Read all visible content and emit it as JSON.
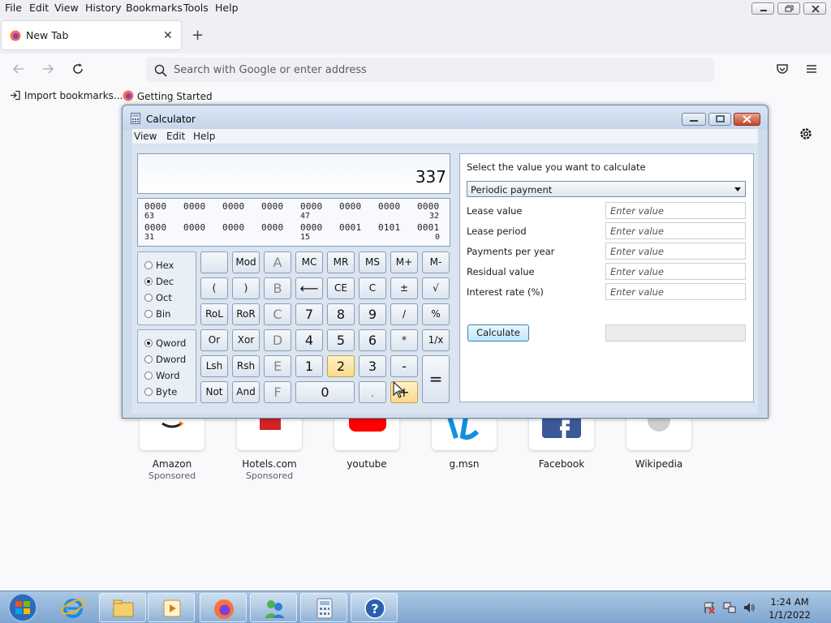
{
  "browser": {
    "menu": [
      "File",
      "Edit",
      "View",
      "History",
      "Bookmarks",
      "Tools",
      "Help"
    ],
    "tab_title": "New Tab",
    "address_placeholder": "Search with Google or enter address",
    "bookmarks": [
      "Import bookmarks...",
      "Getting Started"
    ]
  },
  "shortcuts": [
    {
      "label": "Amazon",
      "sub": "Sponsored"
    },
    {
      "label": "Hotels.com",
      "sub": "Sponsored"
    },
    {
      "label": "youtube",
      "sub": ""
    },
    {
      "label": "g.msn",
      "sub": ""
    },
    {
      "label": "Facebook",
      "sub": ""
    },
    {
      "label": "Wikipedia",
      "sub": ""
    }
  ],
  "calculator": {
    "title": "Calculator",
    "menu": [
      "View",
      "Edit",
      "Help"
    ],
    "display": "337",
    "bits": {
      "row1": [
        "0000",
        "0000",
        "0000",
        "0000",
        "0000",
        "0000",
        "0000",
        "0000"
      ],
      "row1_pos": [
        "63",
        "47",
        "32"
      ],
      "row2": [
        "0000",
        "0000",
        "0000",
        "0000",
        "0000",
        "0001",
        "0101",
        "0001"
      ],
      "row2_pos": [
        "31",
        "15",
        "0"
      ]
    },
    "radix": [
      "Hex",
      "Dec",
      "Oct",
      "Bin"
    ],
    "word_size": [
      "Qword",
      "Dword",
      "Word",
      "Byte"
    ],
    "keys": {
      "r1": [
        "",
        "Mod",
        "A",
        "MC",
        "MR",
        "MS",
        "M+",
        "M-"
      ],
      "r2": [
        "(",
        ")",
        "B",
        "⟵",
        "CE",
        "C",
        "±",
        "√"
      ],
      "r3": [
        "RoL",
        "RoR",
        "C",
        "7",
        "8",
        "9",
        "/",
        "%"
      ],
      "r4": [
        "Or",
        "Xor",
        "D",
        "4",
        "5",
        "6",
        "*",
        "1/x"
      ],
      "r5": [
        "Lsh",
        "Rsh",
        "E",
        "1",
        "2",
        "3",
        "-",
        "="
      ],
      "r6": [
        "Not",
        "And",
        "F",
        "0",
        ".",
        "+"
      ]
    },
    "worksheet": {
      "prompt": "Select the value you want to calculate",
      "selected": "Periodic payment",
      "fields": [
        "Lease value",
        "Lease period",
        "Payments per year",
        "Residual value",
        "Interest rate (%)"
      ],
      "placeholder": "Enter value",
      "button": "Calculate"
    }
  },
  "taskbar": {
    "time": "1:24 AM",
    "date": "1/1/2022"
  }
}
